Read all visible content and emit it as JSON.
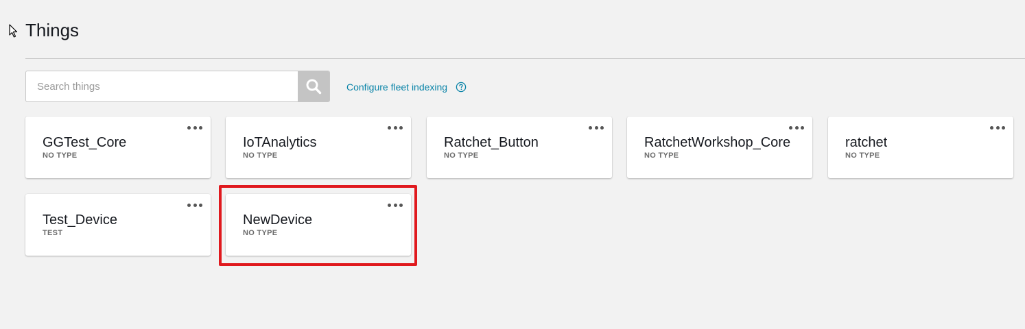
{
  "page": {
    "title": "Things"
  },
  "search": {
    "placeholder": "Search things",
    "value": ""
  },
  "links": {
    "configure_fleet_indexing": "Configure fleet indexing"
  },
  "icons": {
    "cursor": "mouse-pointer-icon",
    "search": "search-icon",
    "help": "help-circle-icon",
    "menu": "more-horizontal-icon"
  },
  "colors": {
    "link": "#0a84a8",
    "highlight": "#e0191e",
    "search_button": "#c4c4c4"
  },
  "things": [
    {
      "name": "GGTest_Core",
      "type": "NO TYPE"
    },
    {
      "name": "IoTAnalytics",
      "type": "NO TYPE"
    },
    {
      "name": "Ratchet_Button",
      "type": "NO TYPE"
    },
    {
      "name": "RatchetWorkshop_Core",
      "type": "NO TYPE"
    },
    {
      "name": "ratchet",
      "type": "NO TYPE"
    },
    {
      "name": "Test_Device",
      "type": "TEST"
    },
    {
      "name": "NewDevice",
      "type": "NO TYPE",
      "highlighted": true
    }
  ]
}
